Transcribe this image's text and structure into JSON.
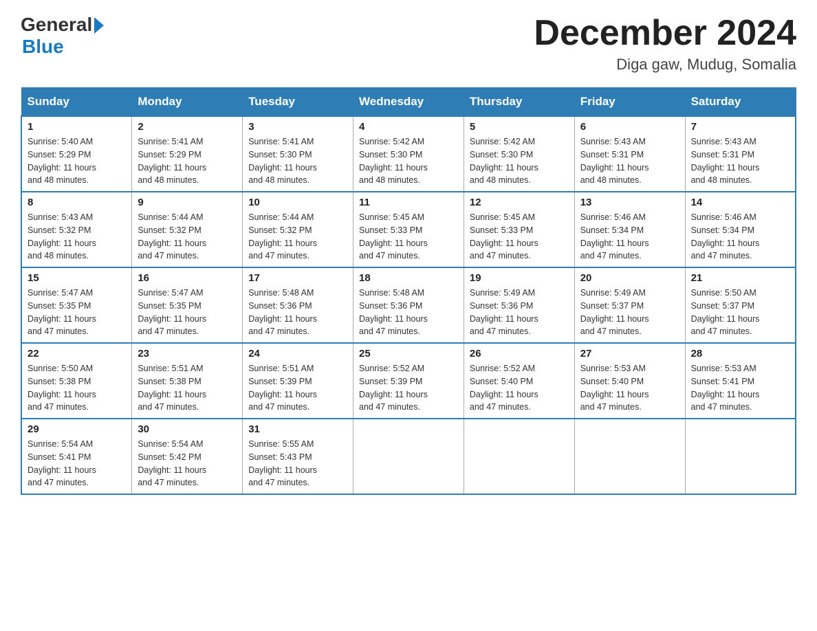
{
  "logo": {
    "general": "General",
    "blue": "Blue"
  },
  "title": "December 2024",
  "subtitle": "Diga gaw, Mudug, Somalia",
  "days_of_week": [
    "Sunday",
    "Monday",
    "Tuesday",
    "Wednesday",
    "Thursday",
    "Friday",
    "Saturday"
  ],
  "weeks": [
    [
      {
        "day": "1",
        "sunrise": "5:40 AM",
        "sunset": "5:29 PM",
        "daylight": "11 hours and 48 minutes."
      },
      {
        "day": "2",
        "sunrise": "5:41 AM",
        "sunset": "5:29 PM",
        "daylight": "11 hours and 48 minutes."
      },
      {
        "day": "3",
        "sunrise": "5:41 AM",
        "sunset": "5:30 PM",
        "daylight": "11 hours and 48 minutes."
      },
      {
        "day": "4",
        "sunrise": "5:42 AM",
        "sunset": "5:30 PM",
        "daylight": "11 hours and 48 minutes."
      },
      {
        "day": "5",
        "sunrise": "5:42 AM",
        "sunset": "5:30 PM",
        "daylight": "11 hours and 48 minutes."
      },
      {
        "day": "6",
        "sunrise": "5:43 AM",
        "sunset": "5:31 PM",
        "daylight": "11 hours and 48 minutes."
      },
      {
        "day": "7",
        "sunrise": "5:43 AM",
        "sunset": "5:31 PM",
        "daylight": "11 hours and 48 minutes."
      }
    ],
    [
      {
        "day": "8",
        "sunrise": "5:43 AM",
        "sunset": "5:32 PM",
        "daylight": "11 hours and 48 minutes."
      },
      {
        "day": "9",
        "sunrise": "5:44 AM",
        "sunset": "5:32 PM",
        "daylight": "11 hours and 47 minutes."
      },
      {
        "day": "10",
        "sunrise": "5:44 AM",
        "sunset": "5:32 PM",
        "daylight": "11 hours and 47 minutes."
      },
      {
        "day": "11",
        "sunrise": "5:45 AM",
        "sunset": "5:33 PM",
        "daylight": "11 hours and 47 minutes."
      },
      {
        "day": "12",
        "sunrise": "5:45 AM",
        "sunset": "5:33 PM",
        "daylight": "11 hours and 47 minutes."
      },
      {
        "day": "13",
        "sunrise": "5:46 AM",
        "sunset": "5:34 PM",
        "daylight": "11 hours and 47 minutes."
      },
      {
        "day": "14",
        "sunrise": "5:46 AM",
        "sunset": "5:34 PM",
        "daylight": "11 hours and 47 minutes."
      }
    ],
    [
      {
        "day": "15",
        "sunrise": "5:47 AM",
        "sunset": "5:35 PM",
        "daylight": "11 hours and 47 minutes."
      },
      {
        "day": "16",
        "sunrise": "5:47 AM",
        "sunset": "5:35 PM",
        "daylight": "11 hours and 47 minutes."
      },
      {
        "day": "17",
        "sunrise": "5:48 AM",
        "sunset": "5:36 PM",
        "daylight": "11 hours and 47 minutes."
      },
      {
        "day": "18",
        "sunrise": "5:48 AM",
        "sunset": "5:36 PM",
        "daylight": "11 hours and 47 minutes."
      },
      {
        "day": "19",
        "sunrise": "5:49 AM",
        "sunset": "5:36 PM",
        "daylight": "11 hours and 47 minutes."
      },
      {
        "day": "20",
        "sunrise": "5:49 AM",
        "sunset": "5:37 PM",
        "daylight": "11 hours and 47 minutes."
      },
      {
        "day": "21",
        "sunrise": "5:50 AM",
        "sunset": "5:37 PM",
        "daylight": "11 hours and 47 minutes."
      }
    ],
    [
      {
        "day": "22",
        "sunrise": "5:50 AM",
        "sunset": "5:38 PM",
        "daylight": "11 hours and 47 minutes."
      },
      {
        "day": "23",
        "sunrise": "5:51 AM",
        "sunset": "5:38 PM",
        "daylight": "11 hours and 47 minutes."
      },
      {
        "day": "24",
        "sunrise": "5:51 AM",
        "sunset": "5:39 PM",
        "daylight": "11 hours and 47 minutes."
      },
      {
        "day": "25",
        "sunrise": "5:52 AM",
        "sunset": "5:39 PM",
        "daylight": "11 hours and 47 minutes."
      },
      {
        "day": "26",
        "sunrise": "5:52 AM",
        "sunset": "5:40 PM",
        "daylight": "11 hours and 47 minutes."
      },
      {
        "day": "27",
        "sunrise": "5:53 AM",
        "sunset": "5:40 PM",
        "daylight": "11 hours and 47 minutes."
      },
      {
        "day": "28",
        "sunrise": "5:53 AM",
        "sunset": "5:41 PM",
        "daylight": "11 hours and 47 minutes."
      }
    ],
    [
      {
        "day": "29",
        "sunrise": "5:54 AM",
        "sunset": "5:41 PM",
        "daylight": "11 hours and 47 minutes."
      },
      {
        "day": "30",
        "sunrise": "5:54 AM",
        "sunset": "5:42 PM",
        "daylight": "11 hours and 47 minutes."
      },
      {
        "day": "31",
        "sunrise": "5:55 AM",
        "sunset": "5:43 PM",
        "daylight": "11 hours and 47 minutes."
      },
      null,
      null,
      null,
      null
    ]
  ],
  "labels": {
    "sunrise": "Sunrise:",
    "sunset": "Sunset:",
    "daylight": "Daylight:"
  }
}
